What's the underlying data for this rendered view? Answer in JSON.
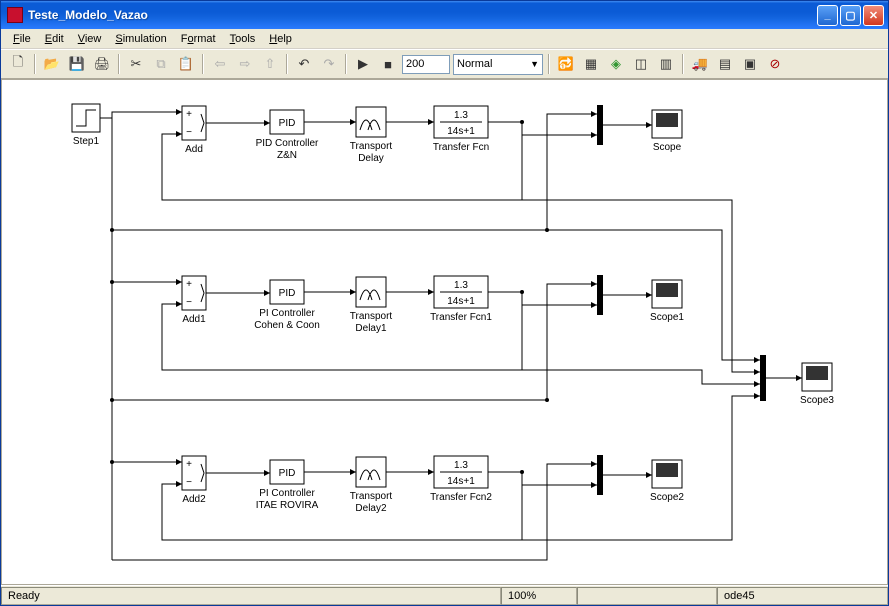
{
  "window": {
    "title": "Teste_Modelo_Vazao"
  },
  "menu": {
    "file": "File",
    "edit": "Edit",
    "view": "View",
    "simulation": "Simulation",
    "format": "Format",
    "tools": "Tools",
    "help": "Help"
  },
  "sim": {
    "stoptime": "200",
    "mode": "Normal"
  },
  "status": {
    "ready": "Ready",
    "zoom": "100%",
    "solver": "ode45"
  },
  "blocks": {
    "step": {
      "label": "Step1"
    },
    "row1": {
      "add": "Add",
      "pid_box": "PID",
      "pid": "PID Controller\nZ&N",
      "td": "Transport\nDelay",
      "tf_num": "1.3",
      "tf_den": "14s+1",
      "tf": "Transfer Fcn",
      "scope": "Scope"
    },
    "row2": {
      "add": "Add1",
      "pid_box": "PID",
      "pid": "PI Controller\nCohen & Coon",
      "td": "Transport\nDelay1",
      "tf_num": "1.3",
      "tf_den": "14s+1",
      "tf": "Transfer Fcn1",
      "scope": "Scope1"
    },
    "row3": {
      "add": "Add2",
      "pid_box": "PID",
      "pid": "PI Controller\nITAE ROVIRA",
      "td": "Transport\nDelay2",
      "tf_num": "1.3",
      "tf_den": "14s+1",
      "tf": "Transfer Fcn2",
      "scope": "Scope2"
    },
    "scope3": "Scope3"
  }
}
